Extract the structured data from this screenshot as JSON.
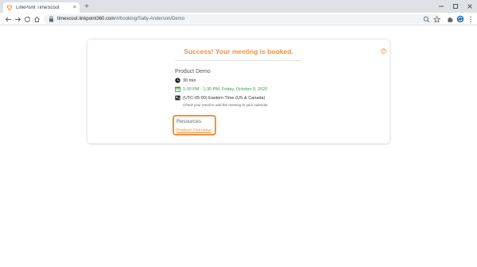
{
  "browser": {
    "tab": {
      "title": "LinkPoint TimeScout",
      "close": "×"
    },
    "new_tab": "+",
    "window": {
      "minimize": "–",
      "maximize": "□",
      "close": "×"
    },
    "url": {
      "host": "timescout.linkpoint360.com",
      "path": "/#/booking/Sally-Anderson/Demo"
    }
  },
  "page": {
    "success_message": "Success! Your meeting is booked.",
    "event_name": "Product Demo",
    "duration": "30 min",
    "datetime": "1:00 PM - 1:30 PM, Friday, October 9, 2020",
    "timezone": "(UTC-05:00) Eastern Time (US & Canada)",
    "email_note": "Check your email to add the meeting to your calendar.",
    "resources": {
      "title": "Resources",
      "link_label": "Product Overview"
    }
  },
  "colors": {
    "accent": "#f0923e",
    "green": "#2e9e44"
  }
}
